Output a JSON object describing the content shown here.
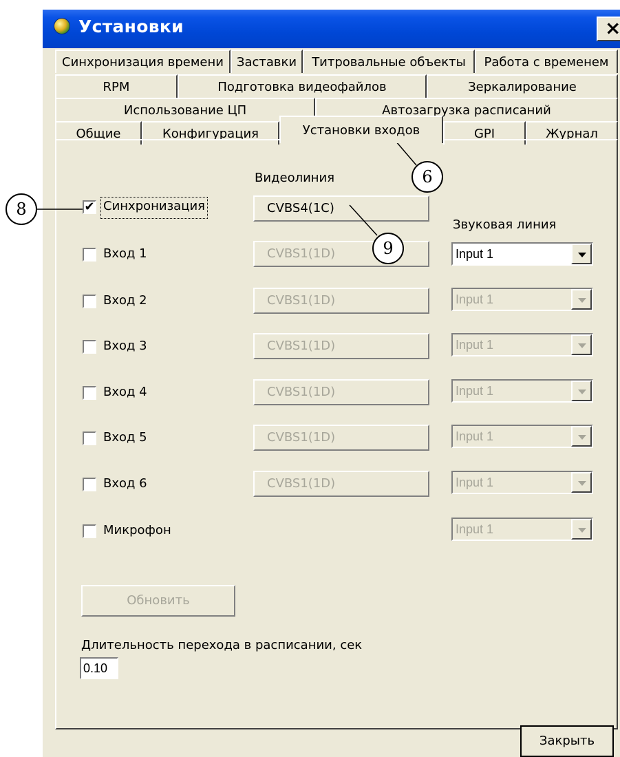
{
  "window": {
    "title": "Установки",
    "close_glyph": "×"
  },
  "tabs": {
    "row1": [
      "Синхронизация времени",
      "Заставки",
      "Титровальные объекты",
      "Работа с временем"
    ],
    "row2": [
      "RPM",
      "Подготовка видеофайлов",
      "Зеркалирование"
    ],
    "row3": [
      "Использование ЦП",
      "Автозагрузка расписаний"
    ],
    "row4": [
      "Общие",
      "Конфигурация",
      "Установки входов",
      "GPI",
      "Журнал"
    ],
    "active": "Установки входов"
  },
  "panel": {
    "video_header": "Видеолиния",
    "audio_header": "Звуковая линия",
    "rows": [
      {
        "label": "Синхронизация",
        "checked": true,
        "check_glyph": "✔",
        "video": "CVBS4(1C)"
      },
      {
        "label": "Вход 1",
        "checked": false,
        "check_glyph": "",
        "video": "CVBS1(1D)",
        "audio": "Input 1"
      },
      {
        "label": "Вход 2",
        "checked": false,
        "check_glyph": "",
        "video": "CVBS1(1D)",
        "audio": "Input 1"
      },
      {
        "label": "Вход 3",
        "checked": false,
        "check_glyph": "",
        "video": "CVBS1(1D)",
        "audio": "Input 1"
      },
      {
        "label": "Вход 4",
        "checked": false,
        "check_glyph": "",
        "video": "CVBS1(1D)",
        "audio": "Input 1"
      },
      {
        "label": "Вход 5",
        "checked": false,
        "check_glyph": "",
        "video": "CVBS1(1D)",
        "audio": "Input 1"
      },
      {
        "label": "Вход 6",
        "checked": false,
        "check_glyph": "",
        "video": "CVBS1(1D)",
        "audio": "Input 1"
      },
      {
        "label": "Микрофон",
        "checked": false,
        "check_glyph": "",
        "audio": "Input 1"
      }
    ],
    "refresh_label": "Обновить",
    "duration_label": "Длительность перехода в расписании, сек",
    "duration_value": "0.10"
  },
  "close_button_label": "Закрыть",
  "callouts": [
    "6",
    "8",
    "9"
  ]
}
